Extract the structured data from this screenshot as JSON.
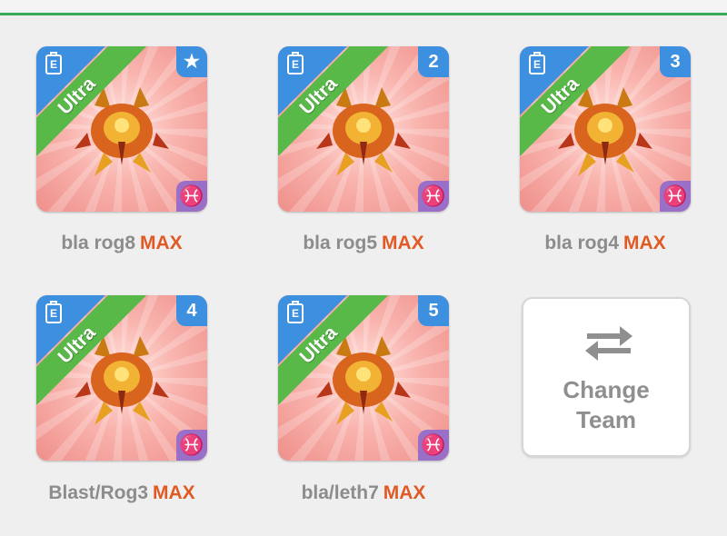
{
  "monsters": [
    {
      "name": "bla rog8",
      "max_label": "MAX",
      "slot": "★",
      "tier": "Ultra",
      "slot_icon": "star-icon",
      "element": "♓"
    },
    {
      "name": "bla rog5",
      "max_label": "MAX",
      "slot": "2",
      "tier": "Ultra",
      "element": "♓"
    },
    {
      "name": "bla rog4",
      "max_label": "MAX",
      "slot": "3",
      "tier": "Ultra",
      "element": "♓"
    },
    {
      "name": "Blast/Rog3",
      "max_label": "MAX",
      "slot": "4",
      "tier": "Ultra",
      "element": "♓"
    },
    {
      "name": "bla/leth7",
      "max_label": "MAX",
      "slot": "5",
      "tier": "Ultra",
      "element": "♓"
    }
  ],
  "card_icon": "E",
  "change_team": {
    "line1": "Change",
    "line2": "Team",
    "icon": "swap-arrows-icon"
  },
  "colors": {
    "accent_green": "#3aa957",
    "max": "#e05a25",
    "tier_ribbon": "#58b848",
    "corner_blue": "#3d8fe0",
    "element_purple": "#9a6fc7"
  }
}
